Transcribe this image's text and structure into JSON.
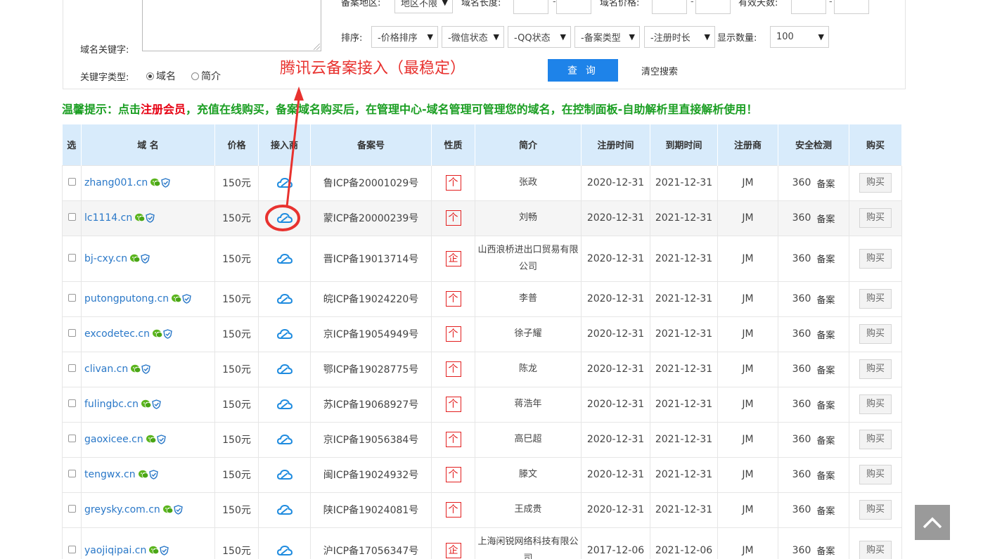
{
  "search": {
    "region_label": "备案地区:",
    "region_value": "地区不限",
    "domain_length_label": "域名长度:",
    "domain_price_label": "域名价格:",
    "valid_days_label": "有效天数:",
    "range_dash": "-",
    "keyword_label": "域名关键字:",
    "sort_label": "排序:",
    "sort_options": [
      "-价格排序",
      "-微信状态",
      "-QQ状态",
      "-备案类型",
      "-注册时长"
    ],
    "display_count_label": "显示数量:",
    "display_count_value": "100",
    "keyword_type_label": "关键字类型:",
    "keyword_type_options": [
      "域名",
      "简介"
    ],
    "query_button": "查 询",
    "clear_button": "清空搜索"
  },
  "annotation": {
    "text": "腾讯云备案接入（最稳定）"
  },
  "tip": {
    "prefix": "温馨提示：点击",
    "link": "注册会员",
    "suffix": "，充值在线购买，备案域名购买后，在管理中心-域名管理可管理您的域名，在控制面板-自助解析里直接解析使用！"
  },
  "table": {
    "headers": [
      "选",
      "域 名",
      "价格",
      "接入商",
      "备案号",
      "性质",
      "简介",
      "注册时间",
      "到期时间",
      "注册商",
      "安全检测",
      "购买"
    ],
    "rows": [
      {
        "domain": "zhang001.cn",
        "price": "150元",
        "icp": "鲁ICP备20001029号",
        "nature": "个",
        "intro": "张政",
        "reg": "2020-12-31",
        "exp": "2021-12-31",
        "registrar": "JM",
        "safe": "360",
        "ba": "备案",
        "buy": "购买"
      },
      {
        "domain": "lc1114.cn",
        "price": "150元",
        "icp": "蒙ICP备20000239号",
        "nature": "个",
        "intro": "刘畅",
        "reg": "2020-12-31",
        "exp": "2021-12-31",
        "registrar": "JM",
        "safe": "360",
        "ba": "备案",
        "buy": "购买"
      },
      {
        "domain": "bj-cxy.cn",
        "price": "150元",
        "icp": "晋ICP备19013714号",
        "nature": "企",
        "intro": "山西浪桥进出口贸易有限公司",
        "reg": "2020-12-31",
        "exp": "2021-12-31",
        "registrar": "JM",
        "safe": "360",
        "ba": "备案",
        "buy": "购买"
      },
      {
        "domain": "putongputong.cn",
        "price": "150元",
        "icp": "皖ICP备19024220号",
        "nature": "个",
        "intro": "李普",
        "reg": "2020-12-31",
        "exp": "2021-12-31",
        "registrar": "JM",
        "safe": "360",
        "ba": "备案",
        "buy": "购买"
      },
      {
        "domain": "excodetec.cn",
        "price": "150元",
        "icp": "京ICP备19054949号",
        "nature": "个",
        "intro": "徐子耀",
        "reg": "2020-12-31",
        "exp": "2021-12-31",
        "registrar": "JM",
        "safe": "360",
        "ba": "备案",
        "buy": "购买"
      },
      {
        "domain": "clivan.cn",
        "price": "150元",
        "icp": "鄂ICP备19028775号",
        "nature": "个",
        "intro": "陈龙",
        "reg": "2020-12-31",
        "exp": "2021-12-31",
        "registrar": "JM",
        "safe": "360",
        "ba": "备案",
        "buy": "购买"
      },
      {
        "domain": "fulingbc.cn",
        "price": "150元",
        "icp": "苏ICP备19068927号",
        "nature": "个",
        "intro": "蒋浩年",
        "reg": "2020-12-31",
        "exp": "2021-12-31",
        "registrar": "JM",
        "safe": "360",
        "ba": "备案",
        "buy": "购买"
      },
      {
        "domain": "gaoxicee.cn",
        "price": "150元",
        "icp": "京ICP备19056384号",
        "nature": "个",
        "intro": "高巳超",
        "reg": "2020-12-31",
        "exp": "2021-12-31",
        "registrar": "JM",
        "safe": "360",
        "ba": "备案",
        "buy": "购买"
      },
      {
        "domain": "tengwx.cn",
        "price": "150元",
        "icp": "闽ICP备19024932号",
        "nature": "个",
        "intro": "滕文",
        "reg": "2020-12-31",
        "exp": "2021-12-31",
        "registrar": "JM",
        "safe": "360",
        "ba": "备案",
        "buy": "购买"
      },
      {
        "domain": "greysky.com.cn",
        "price": "150元",
        "icp": "陕ICP备19024081号",
        "nature": "个",
        "intro": "王成贵",
        "reg": "2020-12-31",
        "exp": "2021-12-31",
        "registrar": "JM",
        "safe": "360",
        "ba": "备案",
        "buy": "购买"
      },
      {
        "domain": "yaojiqipai.cn",
        "price": "150元",
        "icp": "沪ICP备17056347号",
        "nature": "企",
        "intro": "上海闲锐网络科技有限公司",
        "reg": "2017-12-06",
        "exp": "2021-12-06",
        "registrar": "JM",
        "safe": "360",
        "ba": "备案",
        "buy": "购买"
      }
    ]
  },
  "icons": {
    "wechat": "wechat-icon",
    "shield": "shield-check-icon",
    "cloud": "tencent-cloud-icon",
    "backtop": "chevron-up-icon"
  },
  "colors": {
    "accent": "#1e83e9",
    "header_bg": "#d8ebfb",
    "tip_green": "#1a9e22",
    "tip_red": "#e60012",
    "annotation_red": "#e8322f",
    "link_blue": "#2a78c8"
  }
}
